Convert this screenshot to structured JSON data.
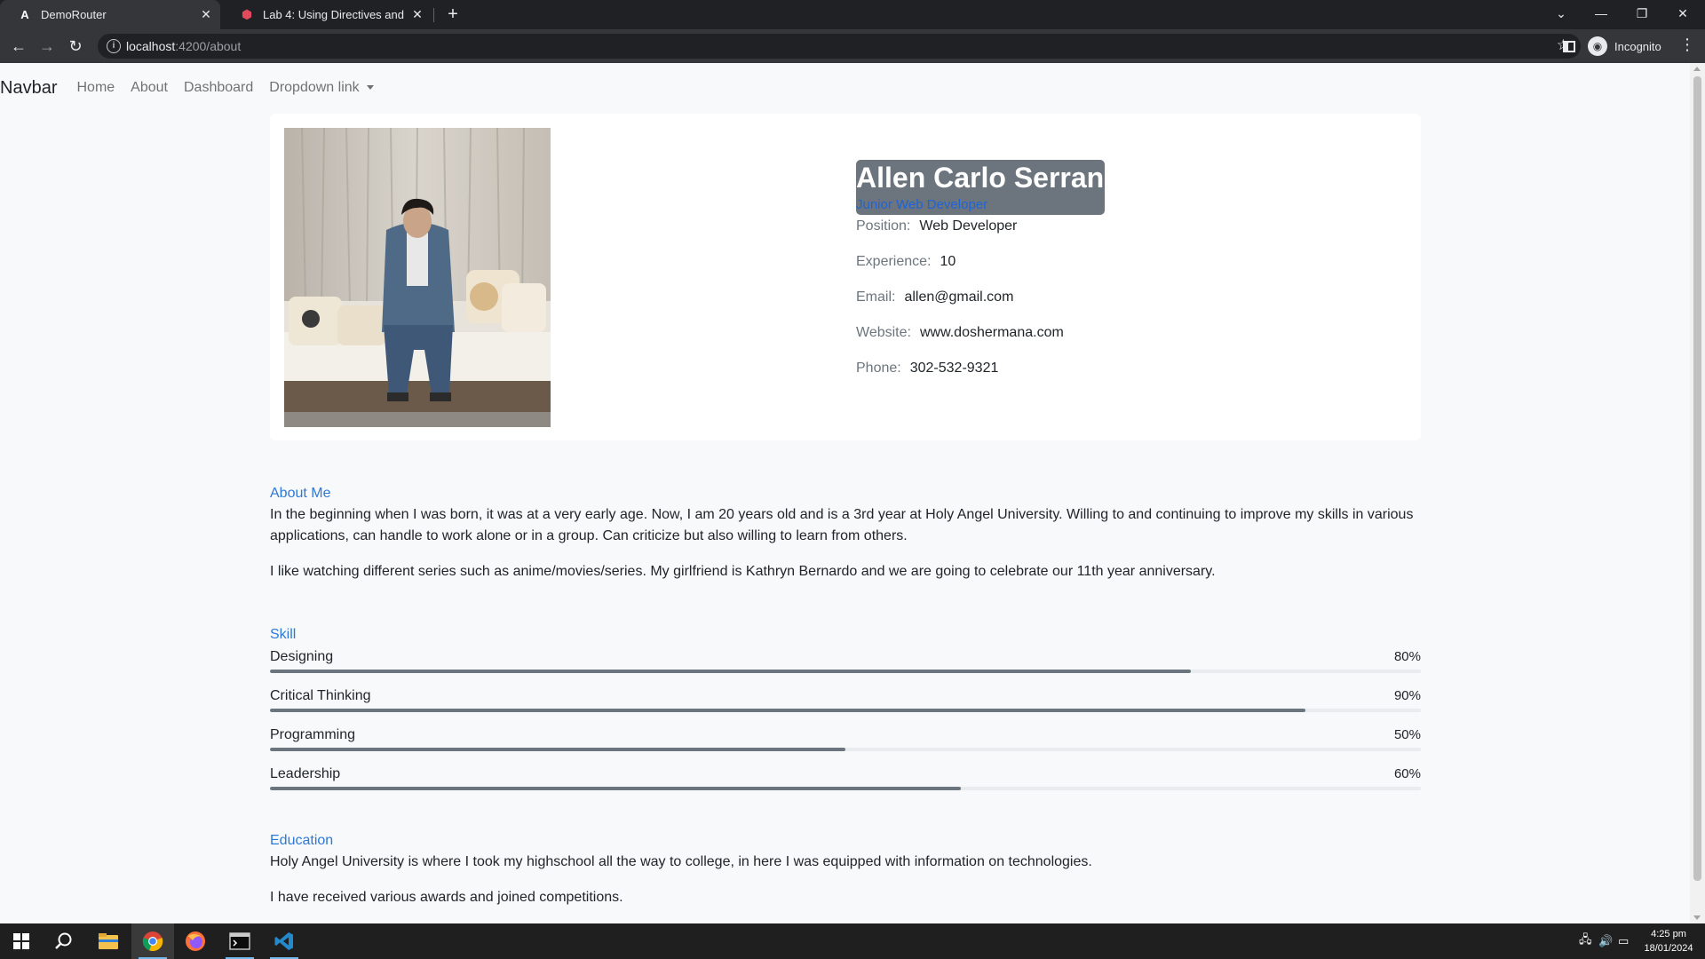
{
  "browser": {
    "tabs": [
      {
        "title": "DemoRouter",
        "active": true
      },
      {
        "title": "Lab 4: Using Directives and Routi",
        "active": false
      }
    ],
    "url_host": "localhost",
    "url_path": ":4200/about",
    "profile_label": "Incognito"
  },
  "navbar": {
    "brand": "Navbar",
    "links": [
      "Home",
      "About",
      "Dashboard"
    ],
    "dropdown_label": "Dropdown link"
  },
  "profile": {
    "name": "Allen Carlo Serrano",
    "title": "Junior Web Developer",
    "fields": [
      {
        "label": "Position:",
        "value": "Web Developer"
      },
      {
        "label": "Experience:",
        "value": "10"
      },
      {
        "label": "Email:",
        "value": "allen@gmail.com"
      },
      {
        "label": "Website:",
        "value": "www.doshermana.com"
      },
      {
        "label": "Phone:",
        "value": "302-532-9321"
      }
    ]
  },
  "about": {
    "heading": "About Me",
    "paragraphs": [
      "In the beginning when I was born, it was at a very early age. Now, I am 20 years old and is a 3rd year at Holy Angel University. Willing to and continuing to improve my skills in various applications, can handle to work alone or in a group. Can criticize but also willing to learn from others.",
      "I like watching different series such as anime/movies/series. My girlfriend is Kathryn Bernardo and we are going to celebrate our 11th year anniversary."
    ]
  },
  "skills": {
    "heading": "Skill",
    "items": [
      {
        "name": "Designing",
        "percent_label": "80%",
        "percent": 80
      },
      {
        "name": "Critical Thinking",
        "percent_label": "90%",
        "percent": 90
      },
      {
        "name": "Programming",
        "percent_label": "50%",
        "percent": 50
      },
      {
        "name": "Leadership",
        "percent_label": "60%",
        "percent": 60
      }
    ]
  },
  "education": {
    "heading": "Education",
    "paragraphs": [
      "Holy Angel University is where I took my highschool all the way to college, in here I was equipped with information on technologies.",
      "I have received various awards and joined competitions."
    ]
  },
  "taskbar": {
    "time": "4:25 pm",
    "date": "18/01/2024"
  },
  "colors": {
    "accent_link": "#2e79d6",
    "progress_fill": "#6c757d",
    "name_highlight": "#6c757d"
  }
}
